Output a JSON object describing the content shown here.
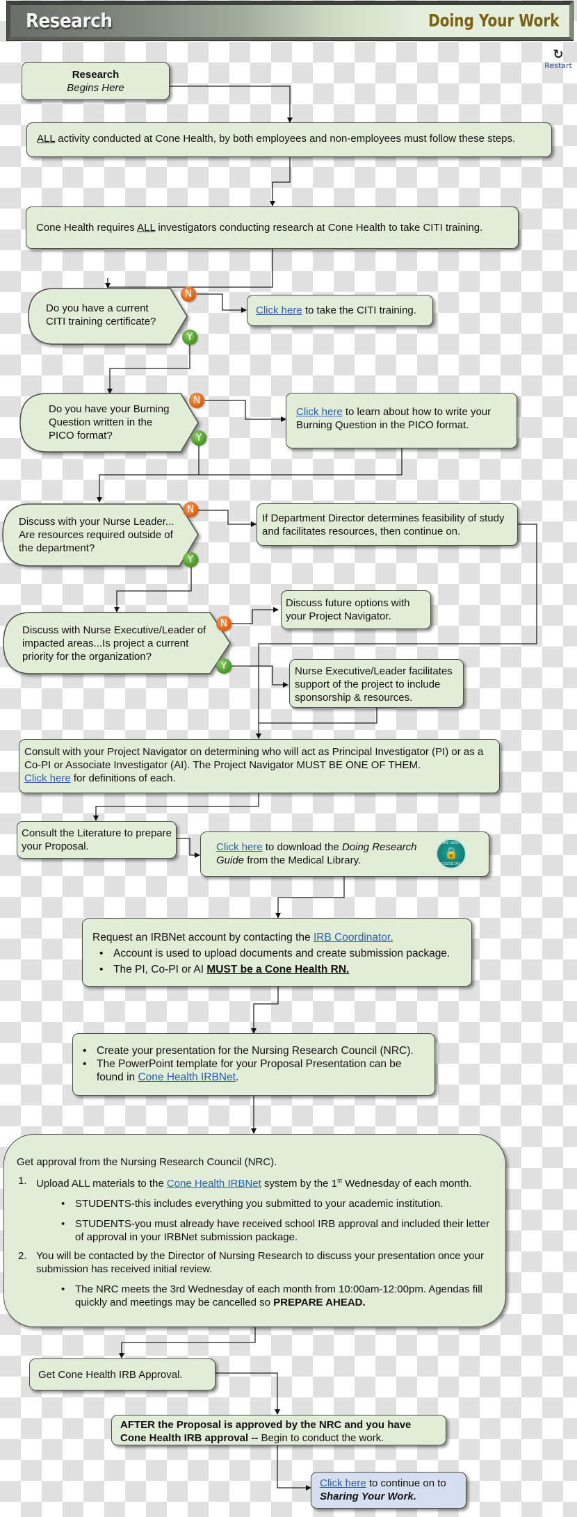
{
  "header": {
    "title": "Research",
    "section": "Doing Your Work",
    "restart_label": "Restart",
    "restart_icon": "restart-icon"
  },
  "colors": {
    "node_fill": "#e2edd8",
    "final_node_fill": "#d5dff0",
    "no_badge": "#e06416",
    "yes_badge": "#4f9a2a",
    "link": "#2a5fb3",
    "section_title": "#7a6010"
  },
  "flow": {
    "start": {
      "line1": "Research",
      "line2": "Begins Here"
    },
    "all_activity": {
      "u": "ALL",
      "rest": " activity conducted at Cone Health, by both employees and non-employees must follow these steps."
    },
    "citi_required": {
      "pre": "Cone Health requires ",
      "u": "ALL",
      "post": " investigators conducting research at Cone Health to take CITI training."
    },
    "q_citi": {
      "text": "Do you have a current CITI training certificate?",
      "no": "N",
      "yes": "Y"
    },
    "citi_link_box": {
      "link": "Click here",
      "rest": " to take the CITI training."
    },
    "q_pico": {
      "text": "Do you have your Burning Question written in the PICO format?",
      "no": "N",
      "yes": "Y"
    },
    "pico_link_box": {
      "link": "Click here",
      "rest": " to learn about how to write your Burning Question in the PICO format."
    },
    "q_nurse_leader": {
      "text": "Discuss with your Nurse Leader... Are resources required outside of the department?",
      "no": "N",
      "yes": "Y"
    },
    "director_box": {
      "text": "If Department Director determines feasibility of study and facilitates resources, then continue on."
    },
    "q_executive": {
      "text": "Discuss with Nurse Executive/Leader of impacted areas...Is project a current priority for the organization?",
      "no": "N",
      "yes": "Y"
    },
    "future_options_box": {
      "text": "Discuss future options with your Project Navigator."
    },
    "executive_support_box": {
      "text": "Nurse Executive/Leader facilitates support of the project to include sponsorship & resources."
    },
    "navigator_box": {
      "text": "Consult with your Project Navigator on determining who will act as Principal Investigator (PI) or as a Co-PI or Associate Investigator (AI).  The Project Navigator MUST BE ONE OF THEM.",
      "link": "Click here",
      "rest": " for definitions of each."
    },
    "literature_box": {
      "text": "Consult the Literature to prepare your Proposal."
    },
    "guide_box": {
      "link": "Click here",
      "mid": " to download the ",
      "italic": "Doing Research Guide",
      "rest": " from the Medical Library.",
      "badge_top": "CONE HEALTH",
      "badge_bottom": "ACCESS ONLY",
      "badge_icon": "lock-icon"
    },
    "irbnet_box": {
      "intro": "Request an IRBNet account by contacting the ",
      "link": "IRB Coordinator.",
      "bullet1": "Account is used to upload documents and create submission package.",
      "bullet2_pre": "The PI, Co-PI or AI ",
      "bullet2_bold": "MUST be a Cone Health RN."
    },
    "presentation_box": {
      "bullet1": "Create your presentation for the Nursing Research Council (NRC).",
      "bullet2_pre": "The PowerPoint template for your Proposal Presentation can be found in ",
      "bullet2_link": "Cone Health IRBNet",
      "bullet2_post": "."
    },
    "nrc_box": {
      "intro": "Get approval from the Nursing Research Council (NRC).",
      "item1_num": "1.",
      "item1_pre": "Upload ALL materials to the ",
      "item1_link": "Cone Health IRBNet",
      "item1_mid": " system by the 1",
      "item1_sup": "st",
      "item1_post": " Wednesday of each month.",
      "item1_bullets": [
        "STUDENTS-this includes everything you submitted to your academic institution.",
        "STUDENTS-you must already have received school IRB approval and included their letter of approval in your IRBNet submission package."
      ],
      "item2_num": "2.",
      "item2_text": "You will be contacted by the Director of Nursing Research to discuss your presentation once your submission has received initial review.",
      "item2_bullet_pre": "The NRC meets the 3rd Wednesday of each month from 10:00am-12:00pm. Agendas fill quickly and meetings may be cancelled so ",
      "item2_bullet_bold": "PREPARE AHEAD."
    },
    "irb_approval_box": {
      "text": "Get Cone Health IRB Approval."
    },
    "after_box": {
      "bold": "AFTER  the Proposal is approved by the NRC and you have Cone Health IRB approval --",
      "rest": " Begin to conduct the work."
    },
    "final_box": {
      "link": "Click here",
      "rest": " to continue on to ",
      "bold_italic": "Sharing Your Work."
    }
  }
}
